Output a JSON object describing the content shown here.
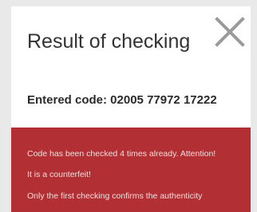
{
  "dialog": {
    "title": "Result of checking",
    "close_icon": "close-icon",
    "entered_code": "Entered code: 02005 77972 17222"
  },
  "alert": {
    "background": "#b22f34",
    "lines": [
      "Code has been checked 4 times already. Attention!",
      "It is a counterfeit!",
      "Only the first checking confirms the authenticity"
    ]
  }
}
